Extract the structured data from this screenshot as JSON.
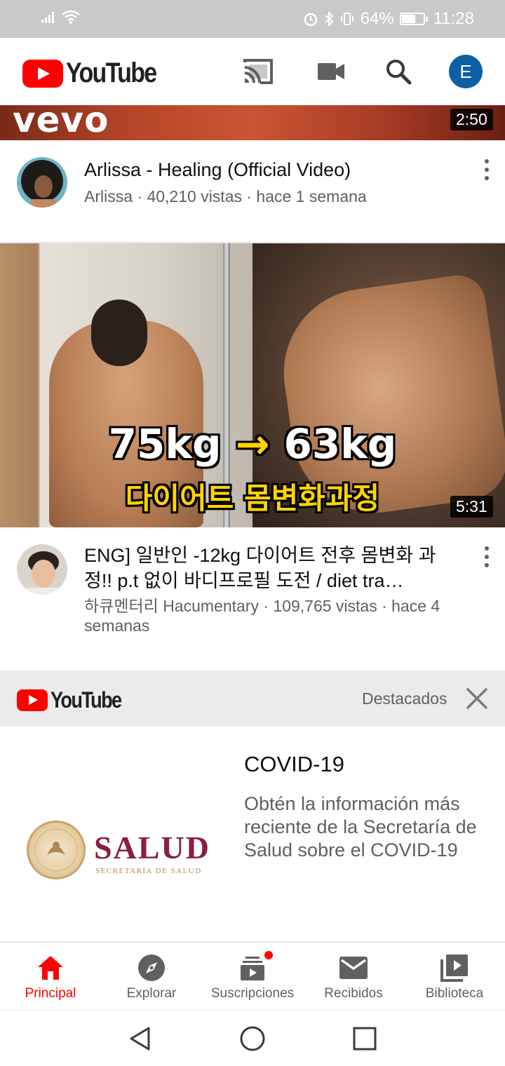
{
  "status_bar": {
    "battery": "64%",
    "battery_level": 0.64,
    "time": "11:28"
  },
  "header": {
    "logo_text": "YouTube",
    "icons": [
      "cast-icon",
      "video-camera-icon",
      "search-icon"
    ],
    "avatar_letter": "E"
  },
  "videos": [
    {
      "thumbnail_text": "vevo",
      "duration": "2:50",
      "title": "Arlissa - Healing (Official Video)",
      "meta": "Arlissa · 40,210 vistas · hace 1 semana"
    },
    {
      "thumbnail_text_line1_a": "75kg",
      "thumbnail_text_line1_b": "63kg",
      "thumbnail_text_line2": "다이어트 몸변화과정",
      "duration": "5:31",
      "title": "ENG] 일반인 -12kg 다이어트 전후 몸변화 과정!! p.t 없이 바디프로필 도전 / diet tra…",
      "meta": "하큐멘터리 Hacumentary · 109,765 vistas · hace 4 semanas"
    }
  ],
  "promo": {
    "logo_text": "YouTube",
    "tag": "Destacados",
    "brand": "SALUD",
    "brand_sub": "SECRETARÍA DE SALUD",
    "title": "COVID-19",
    "description": "Obtén la información más reciente de la Secretaría de Salud sobre el COVID-19"
  },
  "bottom_nav": {
    "items": [
      {
        "label": "Principal",
        "icon": "home-icon",
        "active": true
      },
      {
        "label": "Explorar",
        "icon": "compass-icon"
      },
      {
        "label": "Suscripciones",
        "icon": "subscriptions-icon"
      },
      {
        "label": "Recibidos",
        "icon": "mail-icon"
      },
      {
        "label": "Biblioteca",
        "icon": "library-icon"
      }
    ]
  },
  "colors": {
    "brand_red": "#ff0000",
    "avatar_blue": "#0b5fa5",
    "salud_red": "#8b1e3f"
  }
}
